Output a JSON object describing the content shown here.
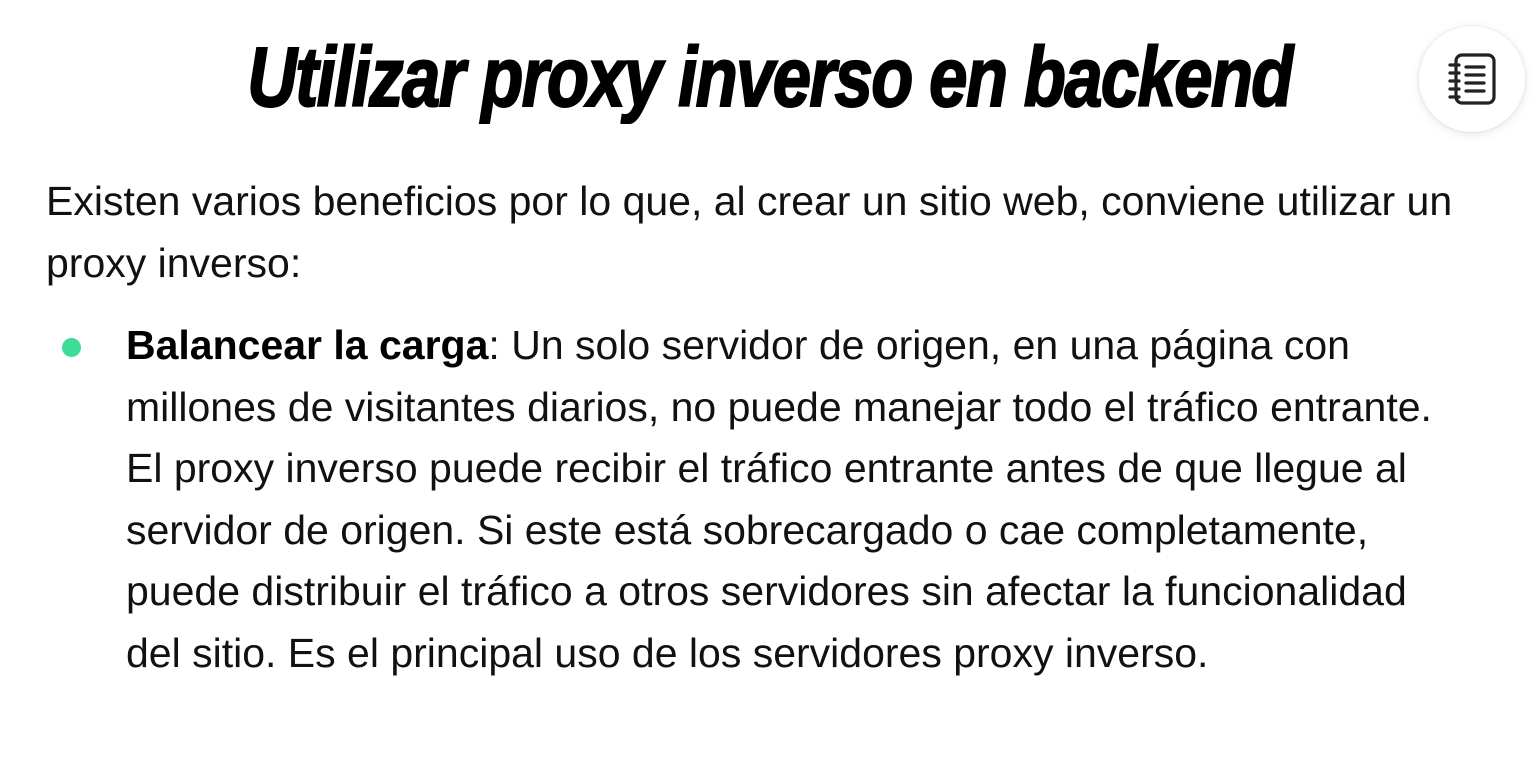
{
  "article": {
    "title": "Utilizar proxy inverso en backend",
    "intro": "Existen varios beneficios por lo que, al crear un sitio web, conviene utilizar un proxy inverso:",
    "bullets": [
      {
        "term": "Balancear la carga",
        "separator": ":",
        "text": " Un solo servidor de origen, en una página con millones de visitantes diarios, no puede manejar todo el tráfico entrante. El proxy inverso puede recibir el tráfico entrante antes de que llegue al servidor de origen. Si este está sobrecargado o cae completamente, puede distribuir el tráfico a otros servidores sin afectar la funcionalidad del sitio. Es el principal uso de los servidores proxy inverso."
      }
    ]
  },
  "toolbar": {
    "notes_icon": "notebook-icon"
  },
  "colors": {
    "bullet": "#3ddc97",
    "text": "#111111",
    "title": "#000000"
  }
}
